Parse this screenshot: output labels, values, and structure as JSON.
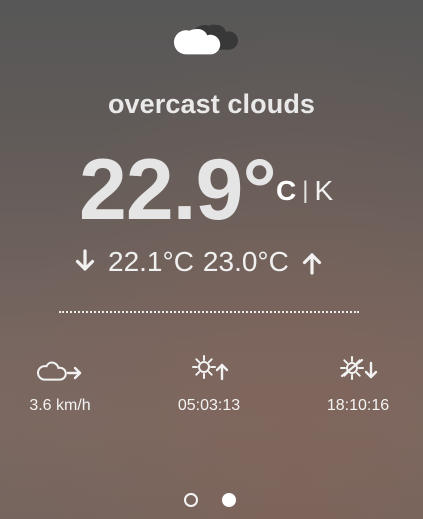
{
  "weather": {
    "description": "overcast clouds",
    "temperature": "22.9°",
    "units": {
      "celsius": "C",
      "separator": "|",
      "kelvin": "K"
    },
    "range": {
      "min": "22.1°C",
      "max": "23.0°C"
    }
  },
  "details": [
    {
      "icon": "wind-cloud-arrow-icon",
      "value": "3.6 km/h"
    },
    {
      "icon": "sunrise-icon",
      "value": "05:03:13"
    },
    {
      "icon": "sunset-icon",
      "value": "18:10:16"
    }
  ],
  "pagination": {
    "total": 2,
    "active_index": 1
  }
}
